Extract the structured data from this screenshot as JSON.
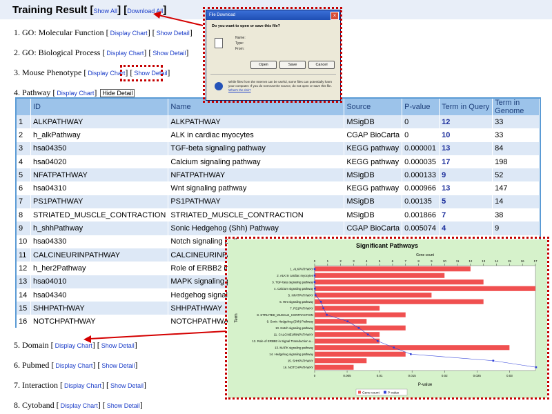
{
  "header": {
    "title": "Training Result",
    "show_all": "Show All",
    "download_all": "Download All"
  },
  "sections": [
    {
      "label": "1. GO: Molecular Function",
      "link1": "Display Chart",
      "link2": "Show Detail"
    },
    {
      "label": "2. GO: Biological Process",
      "link1": "Display Chart",
      "link2": "Show Detail"
    },
    {
      "label": "3. Mouse Phenotype",
      "link1": "Display Chart",
      "link2": "Show Detail"
    },
    {
      "label": "4. Pathway",
      "link1": "Display Chart",
      "link2": "Hide Detail"
    },
    {
      "label": "5. Domain",
      "link1": "Display Chart",
      "link2": "Show Detail"
    },
    {
      "label": "6. Pubmed",
      "link1": "Display Chart",
      "link2": "Show Detail"
    },
    {
      "label": "7. Interaction",
      "link1": "Display Chart",
      "link2": "Show Detail"
    },
    {
      "label": "8. Cytoband",
      "link1": "Display Chart",
      "link2": "Show Detail"
    }
  ],
  "table": {
    "columns": [
      "",
      "ID",
      "Name",
      "Source",
      "P-value",
      "Term in Query",
      "Term in Genome"
    ],
    "rows": [
      [
        "1",
        "ALKPATHWAY",
        "ALKPATHWAY",
        "MSigDB",
        "0",
        "12",
        "33"
      ],
      [
        "2",
        "h_alkPathway",
        "ALK in cardiac myocytes",
        "CGAP BioCarta",
        "0",
        "10",
        "33"
      ],
      [
        "3",
        "hsa04350",
        "TGF-beta signaling pathway",
        "KEGG pathway",
        "0.000001",
        "13",
        "84"
      ],
      [
        "4",
        "hsa04020",
        "Calcium signaling pathway",
        "KEGG pathway",
        "0.000035",
        "17",
        "198"
      ],
      [
        "5",
        "NFATPATHWAY",
        "NFATPATHWAY",
        "MSigDB",
        "0.000133",
        "9",
        "52"
      ],
      [
        "6",
        "hsa04310",
        "Wnt signaling pathway",
        "KEGG pathway",
        "0.000966",
        "13",
        "147"
      ],
      [
        "7",
        "PS1PATHWAY",
        "PS1PATHWAY",
        "MSigDB",
        "0.00135",
        "5",
        "14"
      ],
      [
        "8",
        "STRIATED_MUSCLE_CONTRACTION",
        "STRIATED_MUSCLE_CONTRACTION",
        "MSigDB",
        "0.001866",
        "7",
        "38"
      ],
      [
        "9",
        "h_shhPathway",
        "Sonic Hedgehog (Shh) Pathway",
        "CGAP BioCarta",
        "0.005074",
        "4",
        "9"
      ],
      [
        "10",
        "hsa04330",
        "Notch signaling pathway",
        "",
        "",
        "",
        ""
      ],
      [
        "11",
        "CALCINEURINPATHWAY",
        "CALCINEURINPATHWAY",
        "",
        "",
        "",
        ""
      ],
      [
        "12",
        "h_her2Pathway",
        "Role of ERBB2 in Signal Transduction",
        "",
        "",
        "",
        ""
      ],
      [
        "13",
        "hsa04010",
        "MAPK signaling pathway",
        "",
        "",
        "",
        ""
      ],
      [
        "14",
        "hsa04340",
        "Hedgehog signaling pathway",
        "",
        "",
        "",
        ""
      ],
      [
        "15",
        "SHHPATHWAY",
        "SHHPATHWAY",
        "",
        "",
        "",
        ""
      ],
      [
        "16",
        "NOTCHPATHWAY",
        "NOTCHPATHWAY",
        "",
        "",
        "",
        ""
      ]
    ]
  },
  "dialog": {
    "title": "File Download",
    "question": "Do you want to open or save this file?",
    "name_label": "Name:",
    "type_label": "Type:",
    "from_label": "From:",
    "open": "Open",
    "save": "Save",
    "cancel": "Cancel",
    "warning": "While files from the Internet can be useful, some files can potentially harm your computer. If you do not trust the source, do not open or save this file.",
    "risk_link": "What's the risk?"
  },
  "chart_data": {
    "type": "bar",
    "title": "Significant Pathways",
    "xlabel_top": "Gene count",
    "xlabel_bottom": "P-value",
    "ylabel": "Term",
    "categories": [
      "1. ALKPATHWAY",
      "2. ALK in cardiac myocytes",
      "3. TGF-beta signaling pathway",
      "4. Calcium signaling pathway",
      "5. NFATPATHWAY",
      "6. Wnt signaling pathway",
      "7. PS1PATHWAY",
      "8. STRIATED_MUSCLE_CONTRACTION",
      "9. Sonic Hedgehog (Shh) Pathway",
      "10. Notch signaling pathway",
      "11. CALCINEURINPATHWAY",
      "12. Role of ERBB2 in Signal Transduction a...",
      "13. MAPK signaling pathway",
      "14. Hedgehog signaling pathway",
      "15. SHHPATHWAY",
      "16. NOTCHPATHWAY"
    ],
    "series": [
      {
        "name": "Gene count",
        "values": [
          12,
          10,
          13,
          17,
          9,
          13,
          5,
          7,
          4,
          7,
          5,
          5,
          15,
          7,
          4,
          3
        ],
        "color": "#f05050"
      },
      {
        "name": "P-value",
        "values": [
          0,
          0,
          1e-06,
          3.5e-05,
          0.000133,
          0.000966,
          0.00135,
          0.001866,
          0.005074,
          0.0068,
          0.0082,
          0.0097,
          0.0122,
          0.0148,
          0.0275,
          0.0341
        ],
        "color": "#3040d8"
      }
    ],
    "xlim_top": [
      0,
      17
    ],
    "xticks_top": [
      0,
      1,
      2,
      3,
      4,
      5,
      6,
      7,
      8,
      9,
      10,
      11,
      12,
      13,
      14,
      15,
      16,
      17
    ],
    "xlim_bottom": [
      0,
      0.034
    ],
    "xticks_bottom": [
      "0",
      "0.005",
      "0.01",
      "0.015",
      "0.02",
      "0.025",
      "0.03",
      "0.035"
    ],
    "legend": "bottom"
  }
}
